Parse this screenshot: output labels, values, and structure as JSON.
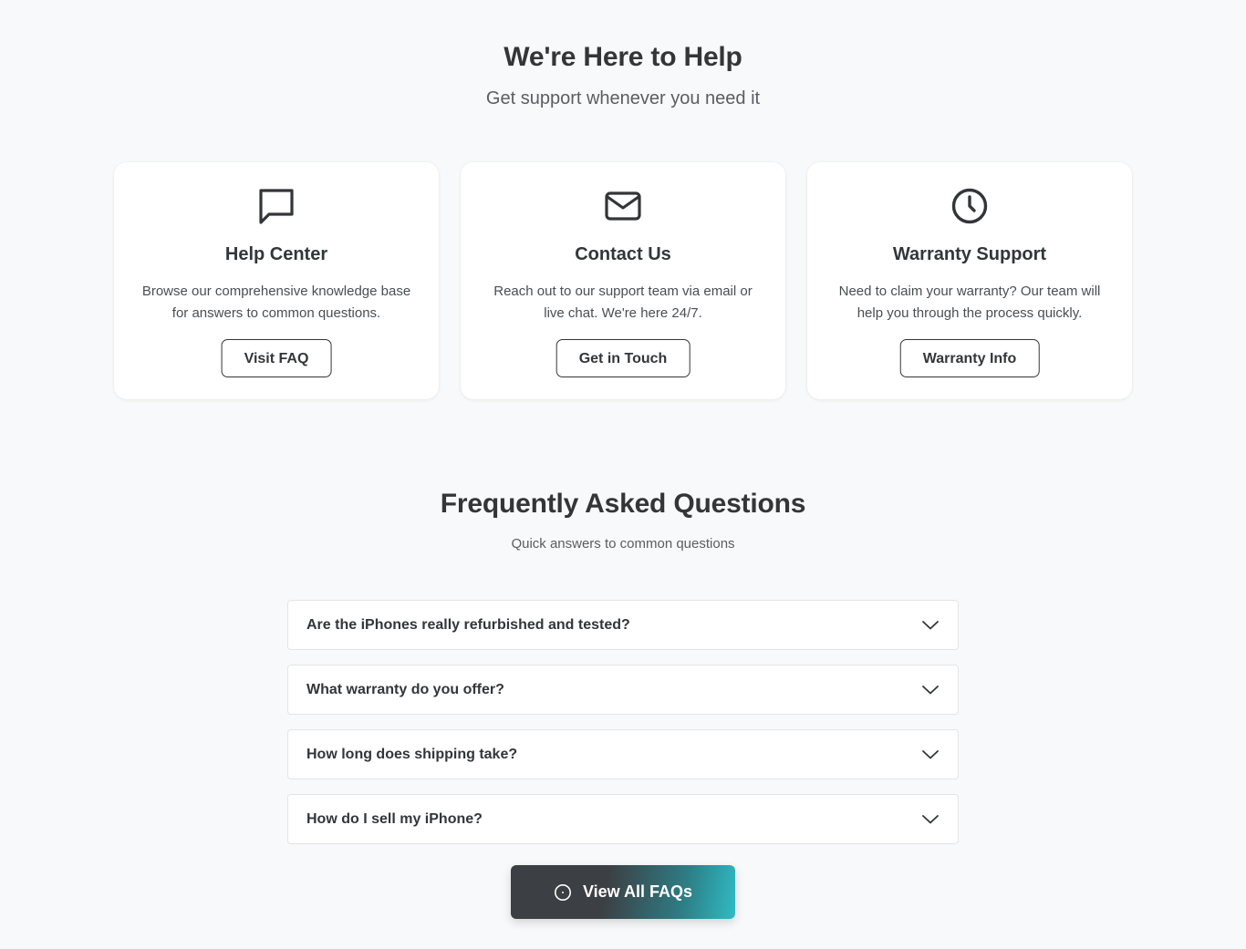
{
  "help": {
    "title": "We're Here to Help",
    "subtitle": "Get support whenever you need it",
    "cards": [
      {
        "icon": "message-square-icon",
        "title": "Help Center",
        "description": "Browse our comprehensive knowledge base for answers to common questions.",
        "button_label": "Visit FAQ"
      },
      {
        "icon": "mail-icon",
        "title": "Contact Us",
        "description": "Reach out to our support team via email or live chat. We're here 24/7.",
        "button_label": "Get in Touch"
      },
      {
        "icon": "clock-icon",
        "title": "Warranty Support",
        "description": "Need to claim your warranty? Our team will help you through the process quickly.",
        "button_label": "Warranty Info"
      }
    ]
  },
  "faq": {
    "title": "Frequently Asked Questions",
    "subtitle": "Quick answers to common questions",
    "items": [
      {
        "question": "Are the iPhones really refurbished and tested?",
        "icon": "chevron-down-icon"
      },
      {
        "question": "What warranty do you offer?",
        "icon": "chevron-down-icon"
      },
      {
        "question": "How long does shipping take?",
        "icon": "chevron-down-icon"
      },
      {
        "question": "How do I sell my iPhone?",
        "icon": "chevron-down-icon"
      }
    ],
    "view_all": {
      "label": "View All FAQs",
      "icon": "info-circle-icon"
    }
  },
  "colors": {
    "background": "#f8f9fa",
    "text": "#333638",
    "card": "#ffffff",
    "gradient_start": "#3c3f43",
    "gradient_end": "#2fbcc4"
  }
}
